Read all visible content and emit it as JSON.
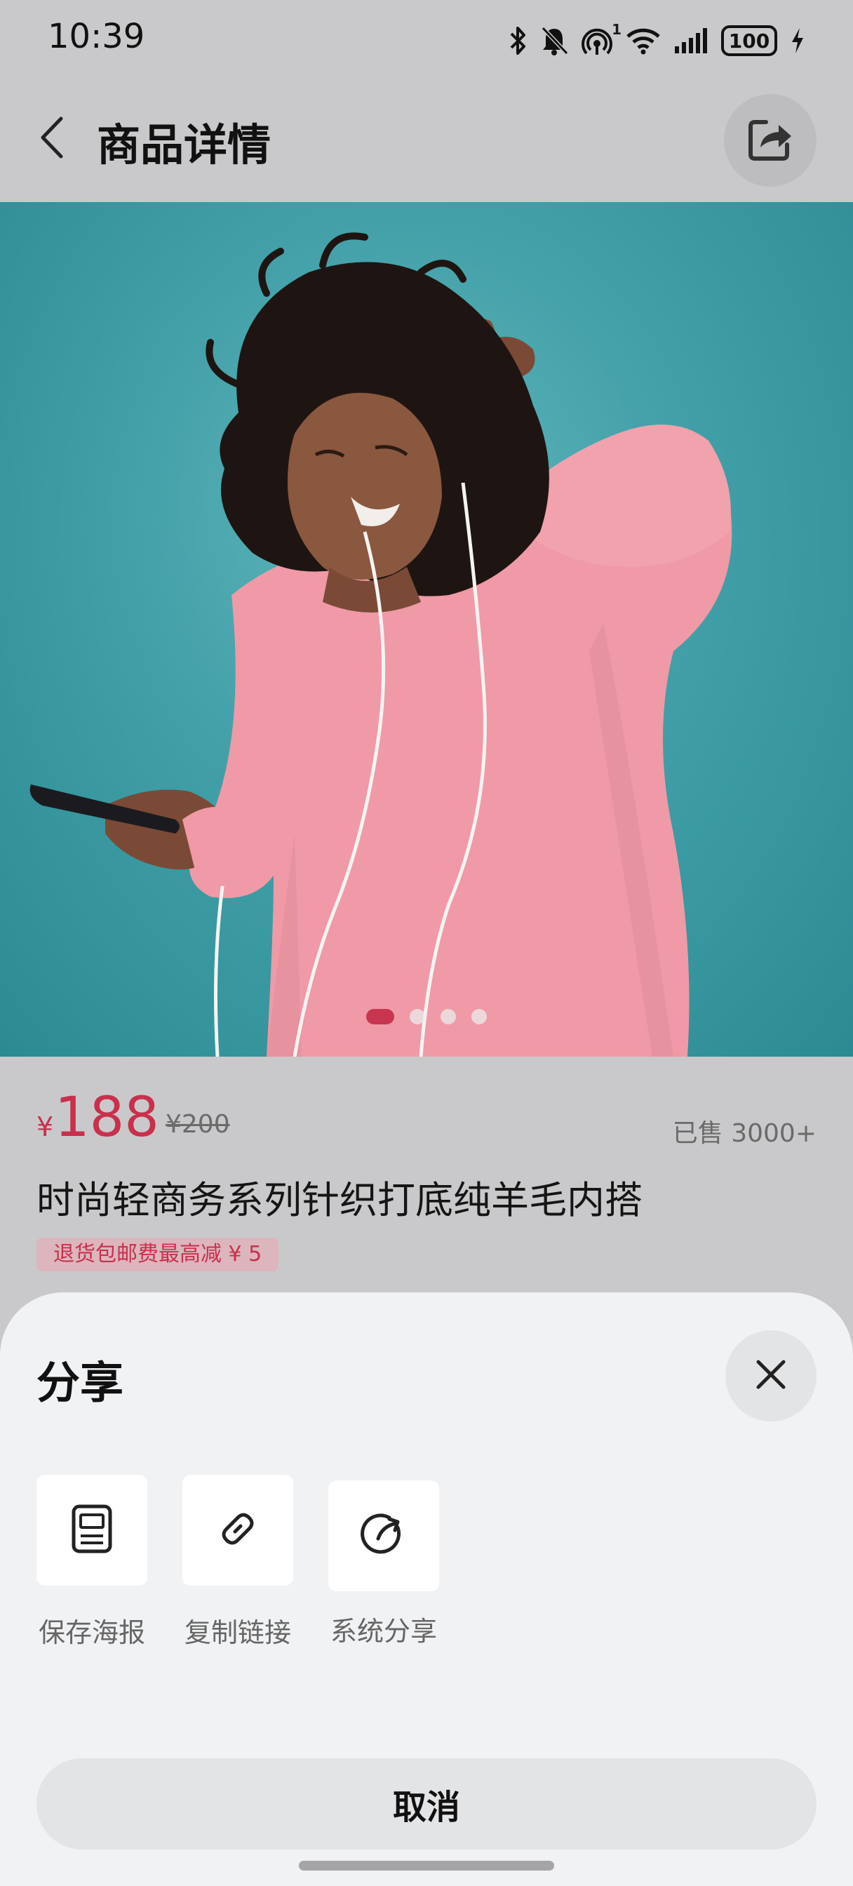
{
  "status_bar": {
    "time": "10:39",
    "hotspot_badge": "1",
    "battery": "100",
    "icons": [
      "bluetooth-icon",
      "mute-bell-icon",
      "hotspot-icon",
      "wifi-icon",
      "signal-icon",
      "battery-icon",
      "charging-icon"
    ]
  },
  "header": {
    "title": "商品详情",
    "back_icon": "chevron-left-icon",
    "share_icon": "share-export-icon"
  },
  "carousel": {
    "total_pages": 4,
    "current_page": 1,
    "image": "woman in pink knit sweater listening to music on turquoise background"
  },
  "product": {
    "currency": "¥",
    "price": "188",
    "original_price": "¥200",
    "sold": "已售 3000+",
    "name": "时尚轻商务系列针织打底纯羊毛内搭",
    "promo": "退货包邮费最高减 ¥ 5"
  },
  "share_sheet": {
    "title": "分享",
    "close_icon": "close-icon",
    "options": [
      {
        "label": "保存海报",
        "icon": "poster-icon"
      },
      {
        "label": "复制链接",
        "icon": "link-icon"
      },
      {
        "label": "系统分享",
        "icon": "system-share-icon"
      }
    ],
    "cancel": "取消"
  },
  "colors": {
    "accent": "#c8304c",
    "backdrop": "#c9c9cb",
    "sheet": "#f1f2f4",
    "hero_bg": "#3d9ca4"
  }
}
